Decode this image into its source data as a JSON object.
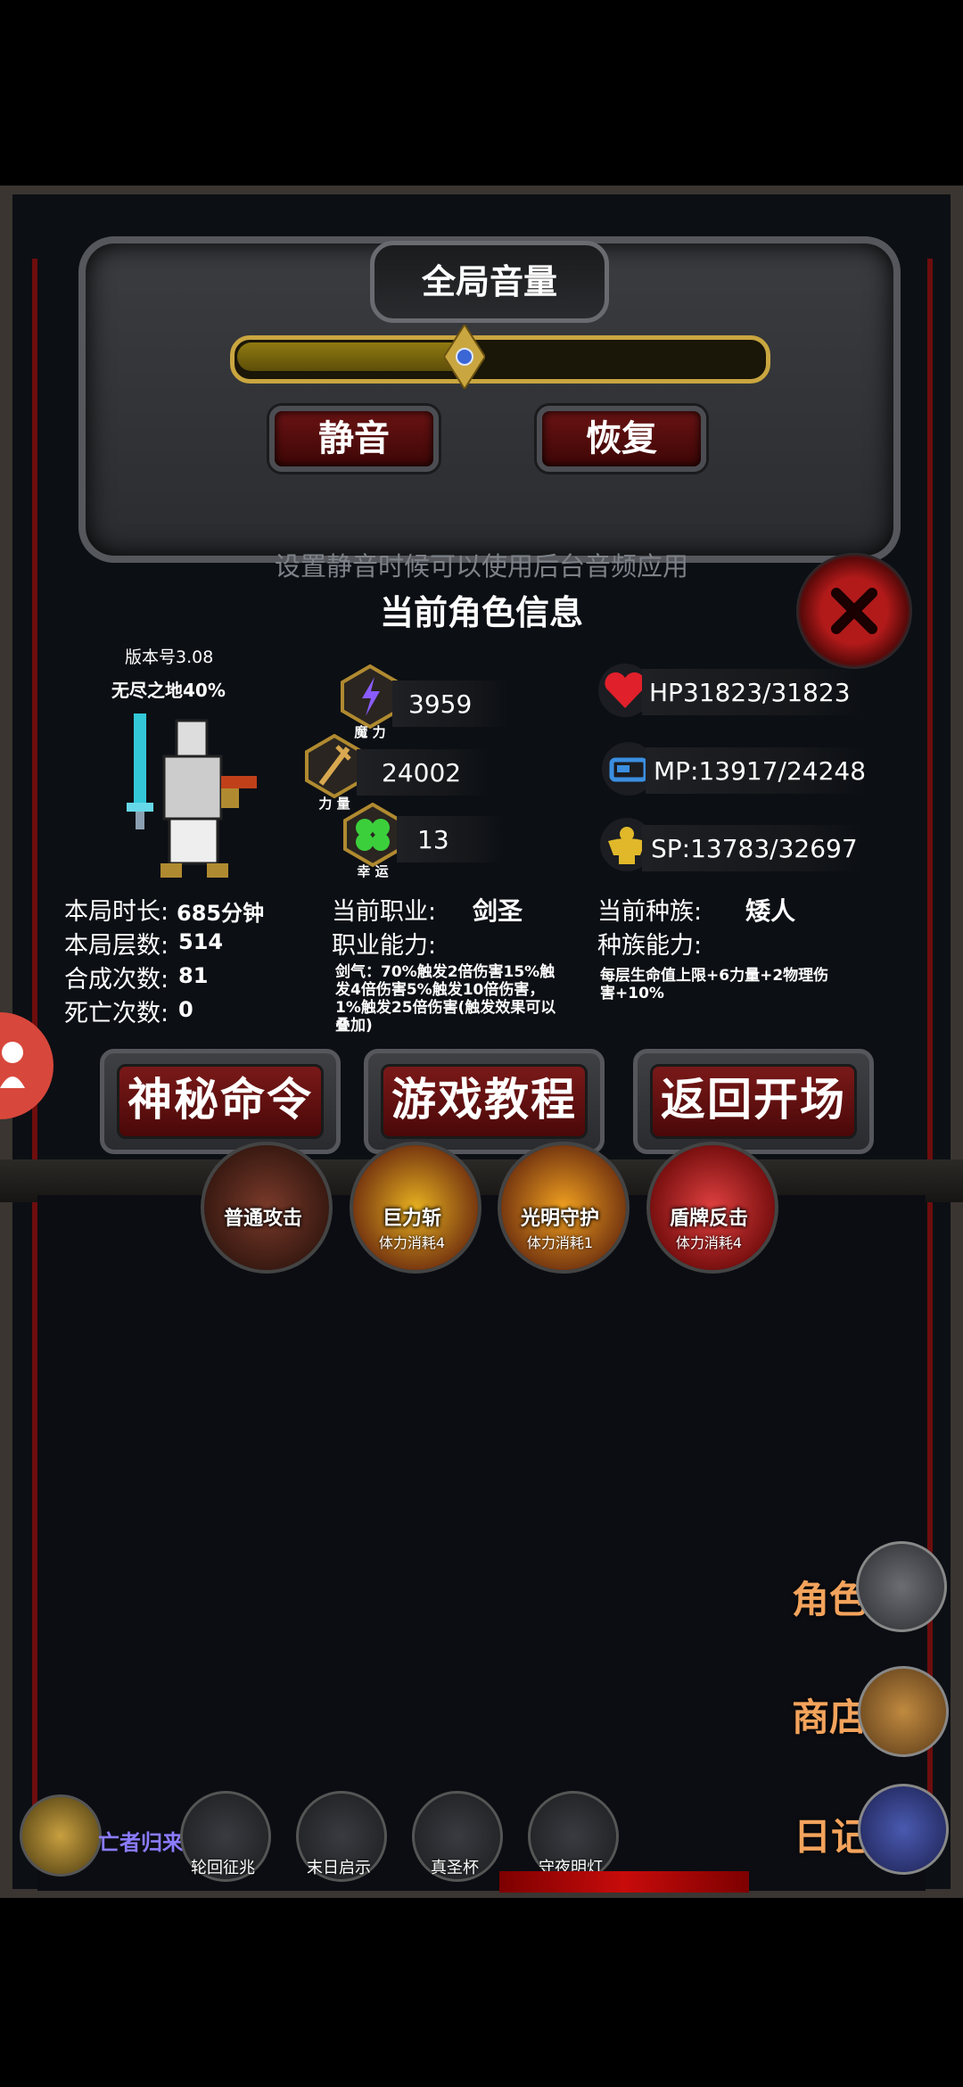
{
  "volume": {
    "title": "全局音量",
    "level": 0.45,
    "mute_label": "静音",
    "restore_label": "恢复",
    "hint": "设置静音时候可以使用后台音频应用"
  },
  "info": {
    "title": "当前角色信息",
    "version": "版本号3.08",
    "stage": "无尽之地40%",
    "magic_value": "3959",
    "magic_caption": "魔 力",
    "strength_value": "24002",
    "strength_caption": "力 量",
    "luck_value": "13",
    "luck_caption": "幸 运",
    "hp": "HP31823/31823",
    "mp": "MP:13917/24248",
    "sp": "SP:13783/32697",
    "time_label": "本局时长:",
    "time_value": "685分钟",
    "floors_label": "本局层数:",
    "floors_value": "514",
    "merge_label": "合成次数:",
    "merge_value": "81",
    "death_label": "死亡次数:",
    "death_value": "0",
    "job_label": "当前职业:",
    "job_value": "剑圣",
    "job_ability_label": "职业能力:",
    "job_ability_desc": "剑气：70%触发2倍伤害15%触发4倍伤害5%触发10倍伤害，1%触发25倍伤害(触发效果可以叠加)",
    "race_label": "当前种族:",
    "race_value": "矮人",
    "race_ability_label": "种族能力:",
    "race_ability_desc": "每层生命值上限+6力量+2物理伤害+10%"
  },
  "commands": {
    "secret": "神秘命令",
    "tutorial": "游戏教程",
    "back": "返回开场"
  },
  "skills": [
    {
      "name": "普通攻击",
      "cost": ""
    },
    {
      "name": "巨力斩",
      "cost": "体力消耗4"
    },
    {
      "name": "光明守护",
      "cost": "体力消耗1"
    },
    {
      "name": "盾牌反击",
      "cost": "体力消耗4"
    }
  ],
  "side_menu": {
    "character": "角色",
    "shop": "商店",
    "diary": "日记"
  },
  "bottom_bar": {
    "player_title": "亡者归来",
    "items": [
      "轮回征兆",
      "末日启示",
      "真圣杯",
      "守夜明灯"
    ]
  },
  "colors": {
    "accent_red": "#7a1919",
    "gold": "#c9a640",
    "side_text": "#f3a35c"
  }
}
